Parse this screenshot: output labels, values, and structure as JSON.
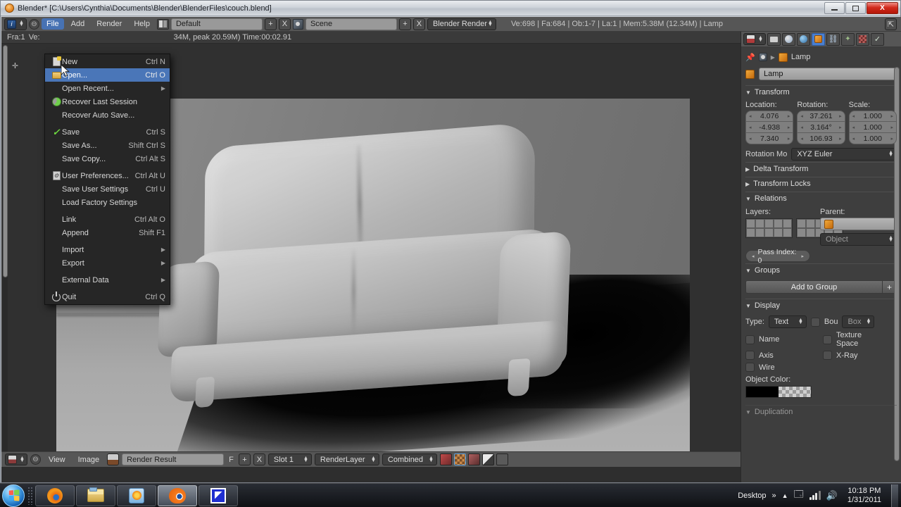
{
  "window": {
    "title": "Blender* [C:\\Users\\Cynthia\\Documents\\Blender\\BlenderFiles\\couch.blend]",
    "minimize_label": "Minimize",
    "restore_label": "Restore",
    "close_label": "X"
  },
  "header": {
    "editor_type_icon": "info-editor-icon",
    "menus": [
      "File",
      "Add",
      "Render",
      "Help"
    ],
    "active_menu": "File",
    "screen_layout": "Default",
    "scene_name": "Scene",
    "engine": "Blender Render",
    "stats": "Ve:698 | Fa:684 | Ob:1-7 | La:1 | Mem:5.38M (12.34M) | Lamp",
    "add_label": "+",
    "remove_label": "X"
  },
  "file_menu": {
    "items": [
      {
        "label": "New",
        "shortcut": "Ctrl N",
        "icon": "new-document-icon",
        "submenu": false,
        "highlighted": false
      },
      {
        "label": "Open...",
        "shortcut": "Ctrl O",
        "icon": "open-folder-icon",
        "submenu": false,
        "highlighted": true
      },
      {
        "label": "Open Recent...",
        "shortcut": "",
        "icon": "none",
        "submenu": true,
        "highlighted": false
      },
      {
        "label": "Recover Last Session",
        "shortcut": "",
        "icon": "recover-icon",
        "submenu": false,
        "highlighted": false
      },
      {
        "label": "Recover Auto Save...",
        "shortcut": "",
        "icon": "none",
        "submenu": false,
        "highlighted": false
      },
      {
        "separator": true
      },
      {
        "label": "Save",
        "shortcut": "Ctrl S",
        "icon": "check-icon",
        "submenu": false,
        "highlighted": false
      },
      {
        "label": "Save As...",
        "shortcut": "Shift Ctrl S",
        "icon": "none",
        "submenu": false,
        "highlighted": false
      },
      {
        "label": "Save Copy...",
        "shortcut": "Ctrl Alt S",
        "icon": "none",
        "submenu": false,
        "highlighted": false
      },
      {
        "separator": true
      },
      {
        "label": "User Preferences...",
        "shortcut": "Ctrl Alt U",
        "icon": "preferences-icon",
        "submenu": false,
        "highlighted": false
      },
      {
        "label": "Save User Settings",
        "shortcut": "Ctrl U",
        "icon": "none",
        "submenu": false,
        "highlighted": false
      },
      {
        "label": "Load Factory Settings",
        "shortcut": "",
        "icon": "none",
        "submenu": false,
        "highlighted": false
      },
      {
        "separator": true
      },
      {
        "label": "Link",
        "shortcut": "Ctrl Alt O",
        "icon": "none",
        "submenu": false,
        "highlighted": false
      },
      {
        "label": "Append",
        "shortcut": "Shift F1",
        "icon": "none",
        "submenu": false,
        "highlighted": false
      },
      {
        "separator": true
      },
      {
        "label": "Import",
        "shortcut": "",
        "icon": "none",
        "submenu": true,
        "highlighted": false
      },
      {
        "label": "Export",
        "shortcut": "",
        "icon": "none",
        "submenu": true,
        "highlighted": false
      },
      {
        "separator": true
      },
      {
        "label": "External Data",
        "shortcut": "",
        "icon": "none",
        "submenu": true,
        "highlighted": false
      },
      {
        "separator": true
      },
      {
        "label": "Quit",
        "shortcut": "Ctrl Q",
        "icon": "power-icon",
        "submenu": false,
        "highlighted": false
      }
    ]
  },
  "render_info": {
    "frame": "Fra:1",
    "verts": "Ve:",
    "memory_tail": "34M, peak 20.59M) Time:00:02.91"
  },
  "image_editor": {
    "menus": [
      "View",
      "Image"
    ],
    "image_name": "Render Result",
    "fake_user_label": "F",
    "add_label": "+",
    "remove_label": "X",
    "slot": "Slot 1",
    "render_layer": "RenderLayer",
    "pass": "Combined"
  },
  "properties": {
    "tabs": [
      "render-tab-icon",
      "scene-tab-icon",
      "world-tab-icon",
      "object-tab-icon",
      "constraints-tab-icon",
      "modifiers-tab-icon",
      "texture-tab-icon",
      "material-tab-icon"
    ],
    "active_tab_index": 3,
    "breadcrumb_object": "Lamp",
    "object_name": "Lamp",
    "transform": {
      "title": "Transform",
      "location_label": "Location:",
      "rotation_label": "Rotation:",
      "scale_label": "Scale:",
      "location": [
        "4.076",
        "-4.938",
        "7.340"
      ],
      "rotation": [
        "37.261",
        "3.164°",
        "106.93"
      ],
      "scale": [
        "1.000",
        "1.000",
        "1.000"
      ],
      "rotation_mode_label": "Rotation Mo",
      "rotation_mode": "XYZ Euler"
    },
    "delta_transform_title": "Delta Transform",
    "transform_locks_title": "Transform Locks",
    "relations": {
      "title": "Relations",
      "layers_label": "Layers:",
      "parent_label": "Parent:",
      "parent_type": "Object",
      "pass_index": "Pass Index: 0"
    },
    "groups": {
      "title": "Groups",
      "add_to_group": "Add to Group",
      "add_icon": "+"
    },
    "display": {
      "title": "Display",
      "type_label": "Type:",
      "type_value": "Text",
      "bounds_label": "Bou",
      "bounds_value": "Box",
      "checkboxes": [
        "Name",
        "Texture Space",
        "Axis",
        "X-Ray",
        "Wire"
      ],
      "object_color_label": "Object Color:",
      "object_color": "#000000"
    },
    "duplication_title": "Duplication"
  },
  "taskbar": {
    "start_label": "Start",
    "buttons": [
      "firefox-icon",
      "explorer-icon",
      "media-player-icon",
      "blender-icon",
      "app-icon"
    ],
    "active_button_index": 3,
    "tray_label": "Desktop",
    "chevron": "»",
    "time": "10:18 PM",
    "date": "1/31/2011"
  },
  "colors": {
    "accent_blue": "#4772b3",
    "blender_orange": "#e87d0d",
    "header_grey": "#565656",
    "panel_grey": "#3e3e3e"
  }
}
